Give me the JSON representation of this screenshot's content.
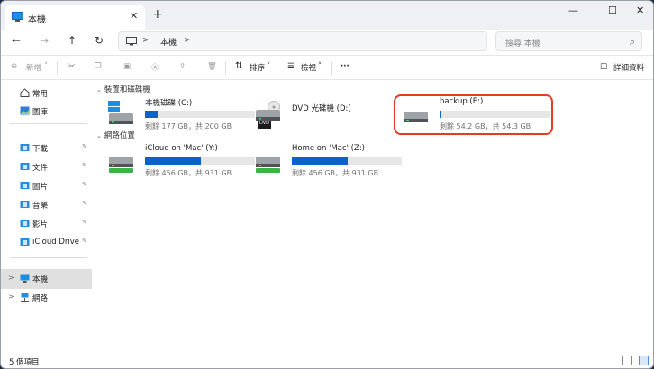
{
  "window": {
    "tab_title": "本機",
    "tab_close": "✕",
    "new_tab": "+",
    "minimize": "—",
    "maximize": "☐",
    "close": "✕"
  },
  "address": {
    "back": "←",
    "forward": "→",
    "up": "↑",
    "refresh": "↻",
    "path_chevron": ">",
    "path_item": "本機",
    "path_chevron2": ">",
    "search_placeholder": "搜尋 本機",
    "search_icon": "⌕"
  },
  "toolbar": {
    "new_label": "新增",
    "new_chevron": "˅",
    "sort_label": "排序",
    "sort_chevron": "˅",
    "view_label": "檢視",
    "view_chevron": "˅",
    "more": "···",
    "details_label": "詳細資料"
  },
  "sidebar": {
    "items": [
      {
        "label": "常用",
        "icon": "home-icon"
      },
      {
        "label": "圖庫",
        "icon": "gallery-icon"
      },
      {
        "label": "下載",
        "icon": "folder-icon",
        "pinned": true
      },
      {
        "label": "文件",
        "icon": "folder-icon",
        "pinned": true
      },
      {
        "label": "圖片",
        "icon": "folder-icon",
        "pinned": true
      },
      {
        "label": "音樂",
        "icon": "folder-icon",
        "pinned": true
      },
      {
        "label": "影片",
        "icon": "folder-icon",
        "pinned": true
      },
      {
        "label": "iCloud Drive (M",
        "icon": "folder-icon",
        "pinned": true
      },
      {
        "label": "本機",
        "icon": "pc-icon",
        "selected": true
      },
      {
        "label": "網路",
        "icon": "network-icon"
      }
    ],
    "pin_glyph": "📌",
    "chevron": ">"
  },
  "main": {
    "group_devices": "裝置和磁碟機",
    "group_network": "網路位置",
    "group_chevron": "⌄",
    "drives": [
      {
        "name": "本機磁碟 (C:)",
        "info": "剩餘 177 GB，共 200 GB",
        "used_fraction": 0.115
      },
      {
        "name": "DVD 光碟機 (D:)",
        "badge": "DVD"
      },
      {
        "name": "backup (E:)",
        "info": "剩餘 54.2 GB，共 54.3 GB",
        "used_fraction": 0.002
      },
      {
        "name": "iCloud on 'Mac' (Y:)",
        "info": "剩餘 456 GB，共 931 GB",
        "used_fraction": 0.51
      },
      {
        "name": "Home on 'Mac' (Z:)",
        "info": "剩餘 456 GB，共 931 GB",
        "used_fraction": 0.51
      }
    ]
  },
  "status": {
    "count": "5 個項目"
  },
  "colors": {
    "accent": "#0a64c8",
    "highlight": "#e53b20"
  }
}
